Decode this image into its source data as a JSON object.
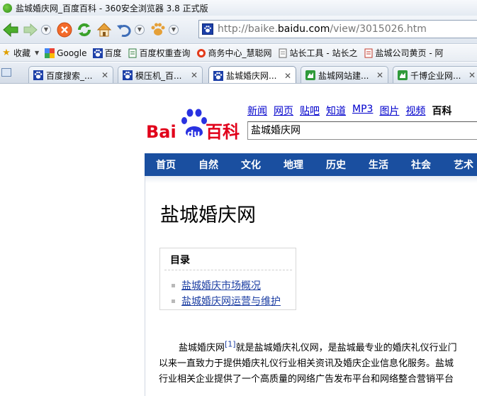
{
  "window": {
    "title": "盐城婚庆网_百度百科 - 360安全浏览器 3.8 正式版"
  },
  "address_bar": {
    "prefix": "http://baike.",
    "domain": "baidu.com",
    "path": "/view/3015026.htm"
  },
  "bookmarks": [
    {
      "label": "收藏",
      "icon": "star-icon"
    },
    {
      "label": "Google",
      "icon": "google-icon"
    },
    {
      "label": "百度",
      "icon": "baidu-paw-icon"
    },
    {
      "label": "百度权重查询",
      "icon": "page-icon"
    },
    {
      "label": "商务中心_慧聪网",
      "icon": "hc-icon"
    },
    {
      "label": "站长工具 - 站长之",
      "icon": "page-icon"
    },
    {
      "label": "盐城公司黄页 - 阿",
      "icon": "page-icon"
    }
  ],
  "tabs": [
    {
      "label": "百度搜索_...",
      "icon": "baidu-paw-icon",
      "active": false
    },
    {
      "label": "模压机_百...",
      "icon": "baidu-paw-icon",
      "active": false
    },
    {
      "label": "盐城婚庆网...",
      "icon": "baidu-paw-icon",
      "active": true
    },
    {
      "label": "盐城网站建...",
      "icon": "green-bird-icon",
      "active": false
    },
    {
      "label": "千博企业网...",
      "icon": "green-bird-icon",
      "active": false
    }
  ],
  "baike": {
    "logo_text_bai": "Bai",
    "logo_text_du": "du",
    "logo_text_baike": "百科",
    "nav": [
      "新闻",
      "网页",
      "贴吧",
      "知道",
      "MP3",
      "图片",
      "视频"
    ],
    "nav_current": "百科",
    "search_value": "盐城婚庆网",
    "categories": [
      "首页",
      "自然",
      "文化",
      "地理",
      "历史",
      "生活",
      "社会",
      "艺术"
    ]
  },
  "article": {
    "title": "盐城婚庆网",
    "toc_heading": "目录",
    "toc_items": [
      "盐城婚庆市场概况",
      "盐城婚庆网运营与维护"
    ],
    "para_line1_a": "盐城婚庆网",
    "para_ref": "[1]",
    "para_line1_b": "就是盐城婚庆礼仪网，是盐城最专业的婚庆礼仪行业门",
    "para_line2": "以来一直致力于提供婚庆礼仪行业相关资讯及婚庆企业信息化服务。盐城",
    "para_line3": "行业相关企业提供了一个高质量的网络广告发布平台和网络整合营销平台"
  },
  "colors": {
    "baidu_red": "#e1001a",
    "baidu_blue": "#2932e1",
    "category_bar": "#1a4fa0",
    "link": "#0000cc"
  }
}
